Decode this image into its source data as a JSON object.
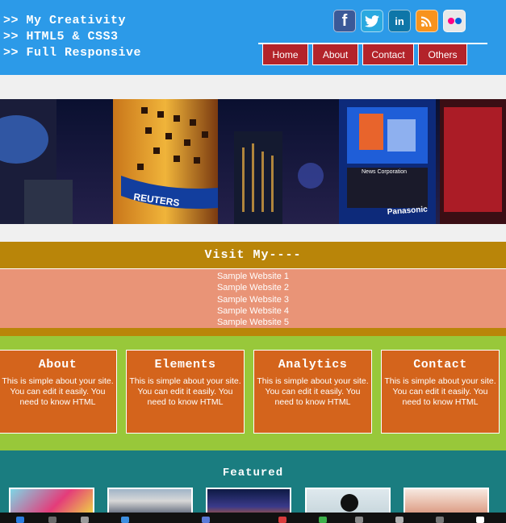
{
  "header": {
    "taglines": [
      ">> My Creativity",
      ">> HTML5 & CSS3",
      ">> Full Responsive"
    ],
    "socials": [
      {
        "name": "facebook-icon",
        "glyph": "f"
      },
      {
        "name": "twitter-icon",
        "glyph": "t"
      },
      {
        "name": "linkedin-icon",
        "glyph": "in"
      },
      {
        "name": "rss-icon",
        "glyph": "◥"
      },
      {
        "name": "flickr-icon",
        "glyph": ""
      }
    ],
    "nav": [
      "Home",
      "About",
      "Contact",
      "Others"
    ]
  },
  "visit": {
    "title": "Visit My----",
    "sites": [
      "Sample Website 1",
      "Sample Website 2",
      "Sample Website 3",
      "Sample Website 4",
      "Sample Website 5"
    ]
  },
  "boxes": [
    {
      "title": "About",
      "text": "This is simple about your site. You can edit it easily. You need to know HTML"
    },
    {
      "title": "Elements",
      "text": "This is simple about your site. You can edit it easily. You need to know HTML"
    },
    {
      "title": "Analytics",
      "text": "This is simple about your site. You can edit it easily. You need to know HTML"
    },
    {
      "title": "Contact",
      "text": "This is simple about your site. You can edit it easily. You need to know HTML"
    }
  ],
  "featured": {
    "title": "Featured"
  },
  "colors": {
    "header_bg": "#2c9ae8",
    "nav_bg": "#b3232a",
    "visit_bar": "#b98509",
    "sites_bg": "#e99477",
    "boxes_bg": "#98c83a",
    "box_bg": "#d4641c",
    "featured_bg": "#1a7d80"
  }
}
